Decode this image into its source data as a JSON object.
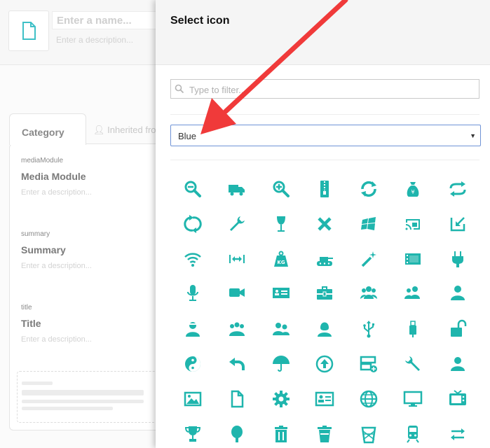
{
  "editor": {
    "name_placeholder": "Enter a name...",
    "description_placeholder": "Enter a description...",
    "tabs": {
      "category": "Category",
      "inherited": "Inherited fro"
    },
    "fields": [
      {
        "key": "mediaModule",
        "name": "Media Module",
        "description": "Enter a description..."
      },
      {
        "key": "summary",
        "name": "Summary",
        "description": "Enter a description..."
      },
      {
        "key": "title",
        "name": "Title",
        "description": "Enter a description..."
      }
    ]
  },
  "modal": {
    "title": "Select icon",
    "filter_placeholder": "Type to filter...",
    "color_select": {
      "selected": "Blue"
    },
    "icon_color": "#1fb5ad",
    "icons": [
      [
        "zoom-out",
        "truck",
        "zoom-in",
        "zip",
        "sync",
        "money-bag",
        "repeat"
      ],
      [
        "refresh",
        "wrench",
        "wine-glass",
        "close",
        "windows-logo",
        "cast",
        "download"
      ],
      [
        "wifi",
        "resize-horizontal",
        "weight-kg",
        "tank",
        "magic-wand",
        "film-strip",
        "plug"
      ],
      [
        "microphone",
        "video-camera",
        "id-card",
        "toolbox",
        "users-group",
        "users",
        "user"
      ],
      [
        "user-beard",
        "users-team",
        "users-alt",
        "user-female",
        "usb",
        "usb-stick",
        "unlock"
      ],
      [
        "yin-yang",
        "undo",
        "umbrella",
        "upload",
        "server-add",
        "wrench-alt",
        "user-circle"
      ],
      [
        "picture",
        "document",
        "gear",
        "contact-card",
        "globe",
        "monitor",
        "tv"
      ],
      [
        "trophy",
        "tree",
        "trash",
        "trash-alt",
        "waste-bin",
        "train",
        "transfer"
      ]
    ]
  },
  "annotation": {
    "arrow_color": "#f03a3a"
  }
}
